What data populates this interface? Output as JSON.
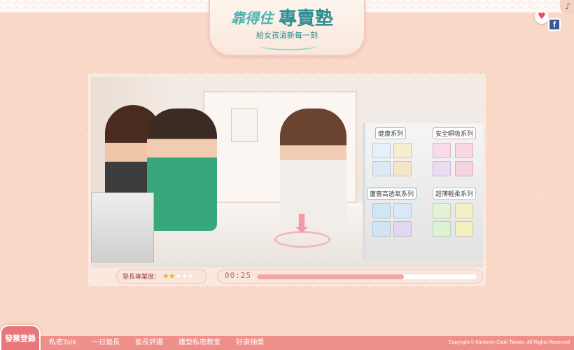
{
  "logo": {
    "left": "靠得住",
    "right": "專賣塾",
    "subtitle": "給女孩清新每一刻"
  },
  "icons": {
    "music": "music-note-icon",
    "heart": "heart-icon",
    "facebook": "facebook-icon",
    "facebook_letter": "f"
  },
  "stage": {
    "series": [
      {
        "label": "健康系列",
        "color": "#8cc9a1"
      },
      {
        "label": "安全瞬吸系列",
        "color": "#e49ab9"
      },
      {
        "label": "蘆薈高透氧系列",
        "color": "#7db7d6"
      },
      {
        "label": "超薄輕柔系列",
        "color": "#9cd5a7"
      }
    ]
  },
  "status": {
    "expertise_label": "塾長專業度：",
    "stars_filled": 2,
    "stars_total": 5,
    "timer": "00:25",
    "progress": 0.67
  },
  "nav": {
    "invoice_button": "發票登錄",
    "items": [
      "私密Talk",
      "一日塾長",
      "塾長評鑑",
      "護墊私密教室",
      "好康抽獎"
    ]
  },
  "footer": {
    "copyright": "Copyright © Kimberly-Clark Taiwan. All Rights Reserved"
  }
}
